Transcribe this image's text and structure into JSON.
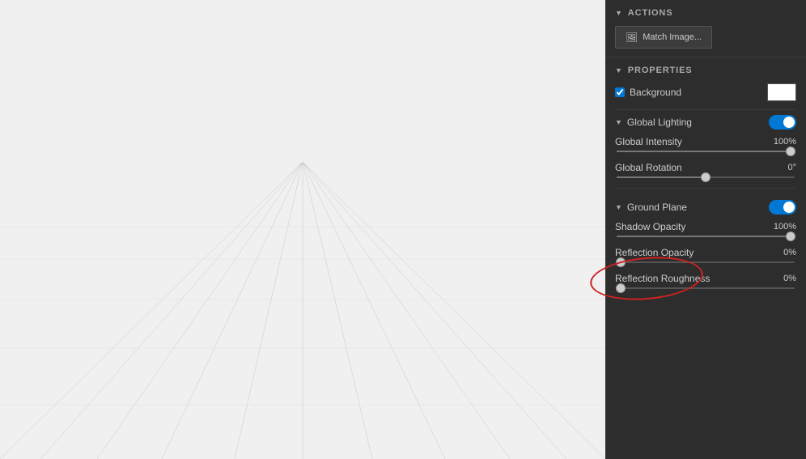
{
  "canvas": {
    "background": "#f0f0f0"
  },
  "panel": {
    "actions_header": "ACTIONS",
    "match_image_label": "Match Image...",
    "properties_header": "PROPERTIES",
    "background_label": "Background",
    "background_checked": true,
    "background_color": "#ffffff",
    "global_lighting_label": "Global Lighting",
    "global_lighting_enabled": true,
    "global_intensity_label": "Global Intensity",
    "global_intensity_value": "100%",
    "global_intensity_percent": 100,
    "global_rotation_label": "Global Rotation",
    "global_rotation_value": "0°",
    "global_rotation_percent": 50,
    "ground_plane_label": "Ground Plane",
    "ground_plane_enabled": true,
    "shadow_opacity_label": "Shadow Opacity",
    "shadow_opacity_value": "100%",
    "shadow_opacity_percent": 100,
    "reflection_opacity_label": "Reflection Opacity",
    "reflection_opacity_value": "0%",
    "reflection_opacity_percent": 0,
    "reflection_roughness_label": "Reflection Roughness",
    "reflection_roughness_value": "0%",
    "reflection_roughness_percent": 0
  }
}
